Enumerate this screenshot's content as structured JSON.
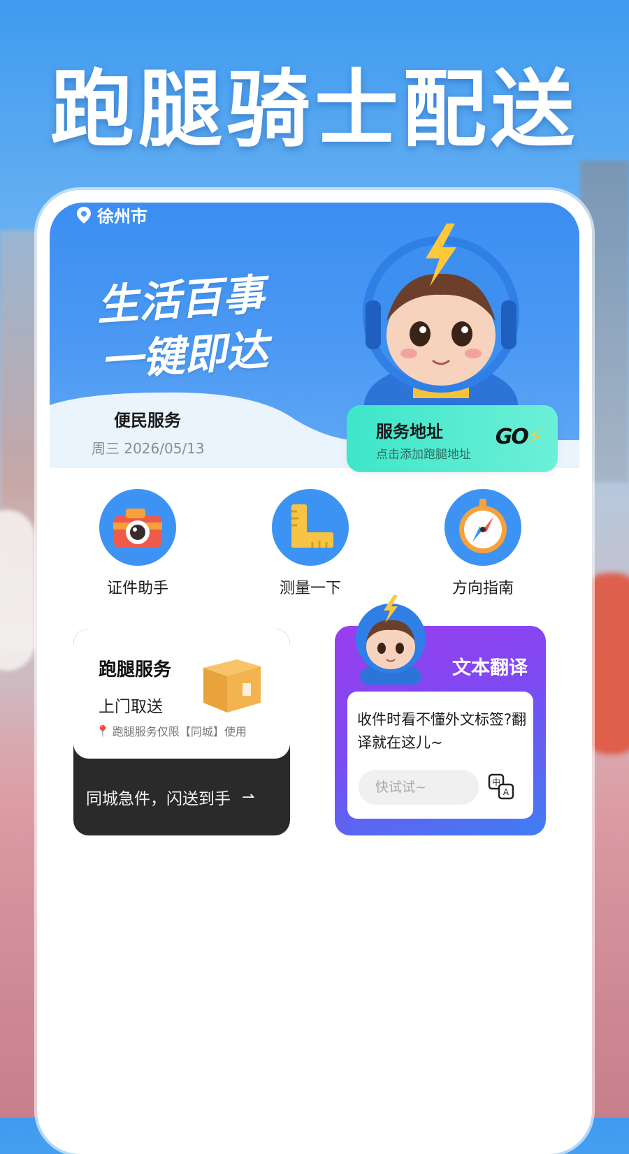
{
  "headline": "跑腿骑士配送",
  "location": {
    "city": "徐州市"
  },
  "hero": {
    "slogan_line1": "生活百事",
    "slogan_line2": "一键即达"
  },
  "service": {
    "title": "便民服务",
    "date": "周三 2026/05/13"
  },
  "address_card": {
    "title": "服务地址",
    "subtitle": "点击添加跑腿地址",
    "go_label": "GO"
  },
  "tools": [
    {
      "label": "证件助手",
      "icon": "camera-icon"
    },
    {
      "label": "测量一下",
      "icon": "ruler-icon"
    },
    {
      "label": "方向指南",
      "icon": "compass-icon"
    }
  ],
  "run_card": {
    "title": "跑腿服务",
    "subtitle": "上门取送",
    "note": "跑腿服务仅限【同城】使用",
    "bottom": "同城急件，闪送到手",
    "arrow": "⇀"
  },
  "translate_card": {
    "title": "文本翻译",
    "text": "收件时看不懂外文标签?翻译就在这儿~",
    "placeholder": "快试试~"
  },
  "colors": {
    "primary_blue": "#3b8ef2",
    "teal": "#3ee6c9",
    "purple": "#9b3df0",
    "dark": "#2b2a2a"
  }
}
